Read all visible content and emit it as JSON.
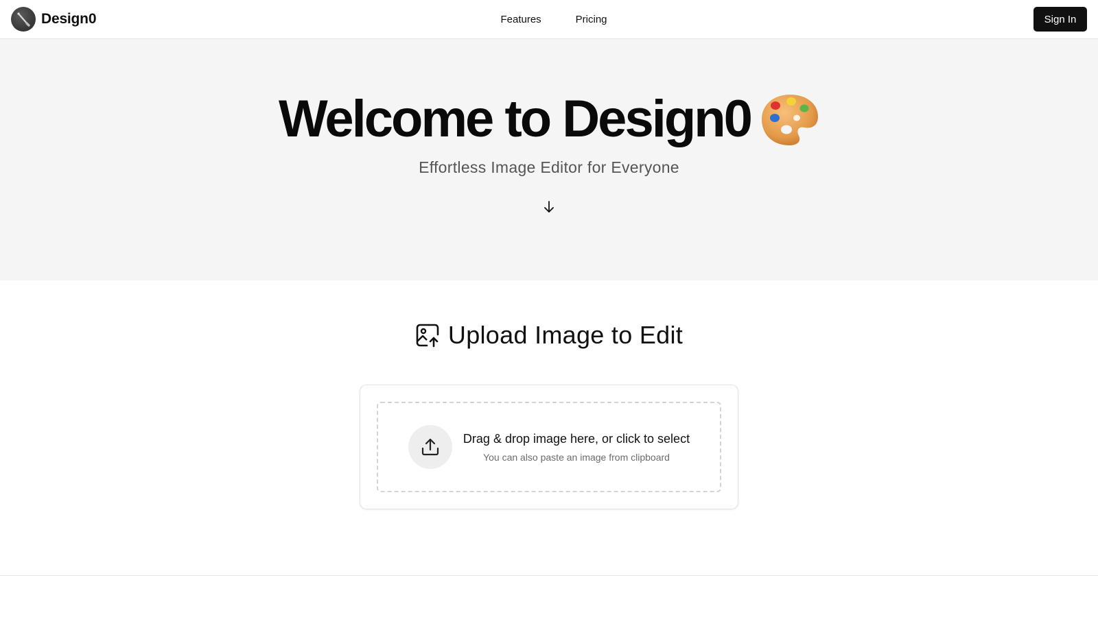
{
  "header": {
    "brand_name": "Design0",
    "nav": [
      {
        "label": "Features"
      },
      {
        "label": "Pricing"
      }
    ],
    "signin_label": "Sign In"
  },
  "hero": {
    "title": "Welcome to Design0",
    "subtitle": "Effortless Image Editor for Everyone"
  },
  "upload": {
    "heading": "Upload Image to Edit",
    "drop_title": "Drag & drop image here, or click to select",
    "drop_hint": "You can also paste an image from clipboard"
  },
  "icons": {
    "brand": "brush-logo-icon",
    "hero": "artist-palette-icon",
    "scroll": "arrow-down-icon",
    "heading": "image-upload-icon",
    "dropzone": "upload-icon"
  },
  "colors": {
    "primary": "#111111",
    "hero_bg": "#f5f5f5",
    "muted_text": "#555555",
    "border": "#e5e5e5"
  }
}
